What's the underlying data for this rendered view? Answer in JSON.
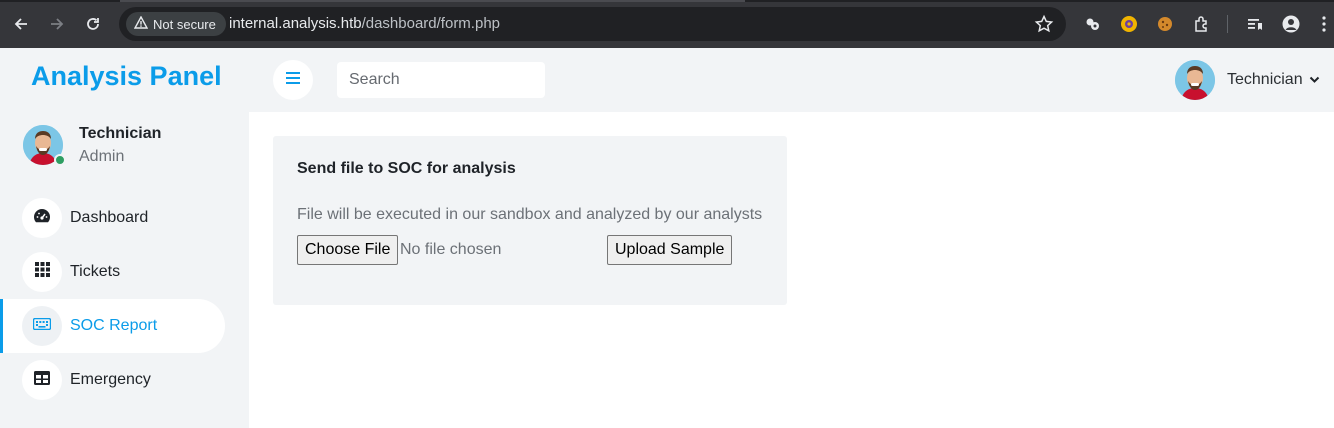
{
  "browser": {
    "security_label": "Not secure",
    "url_host": "internal.analysis.htb",
    "url_path": "/dashboard/form.php"
  },
  "header": {
    "brand": "Analysis Panel",
    "search_placeholder": "Search",
    "user_name": "Technician"
  },
  "sidebar": {
    "profile": {
      "name": "Technician",
      "role": "Admin"
    },
    "items": [
      {
        "label": "Dashboard",
        "icon": "dashboard-gauge-icon",
        "active": false
      },
      {
        "label": "Tickets",
        "icon": "grid-icon",
        "active": false
      },
      {
        "label": "SOC Report",
        "icon": "keyboard-icon",
        "active": true
      },
      {
        "label": "Emergency",
        "icon": "table-icon",
        "active": false
      }
    ]
  },
  "main": {
    "card_title": "Send file to SOC for analysis",
    "description": "File will be executed in our sandbox and analyzed by our analysts",
    "choose_file_label": "Choose File",
    "no_file_text": "No file chosen",
    "upload_label": "Upload Sample"
  },
  "colors": {
    "accent": "#0b9ce9",
    "panel_bg": "#f2f4f6",
    "online": "#2e9e62"
  }
}
